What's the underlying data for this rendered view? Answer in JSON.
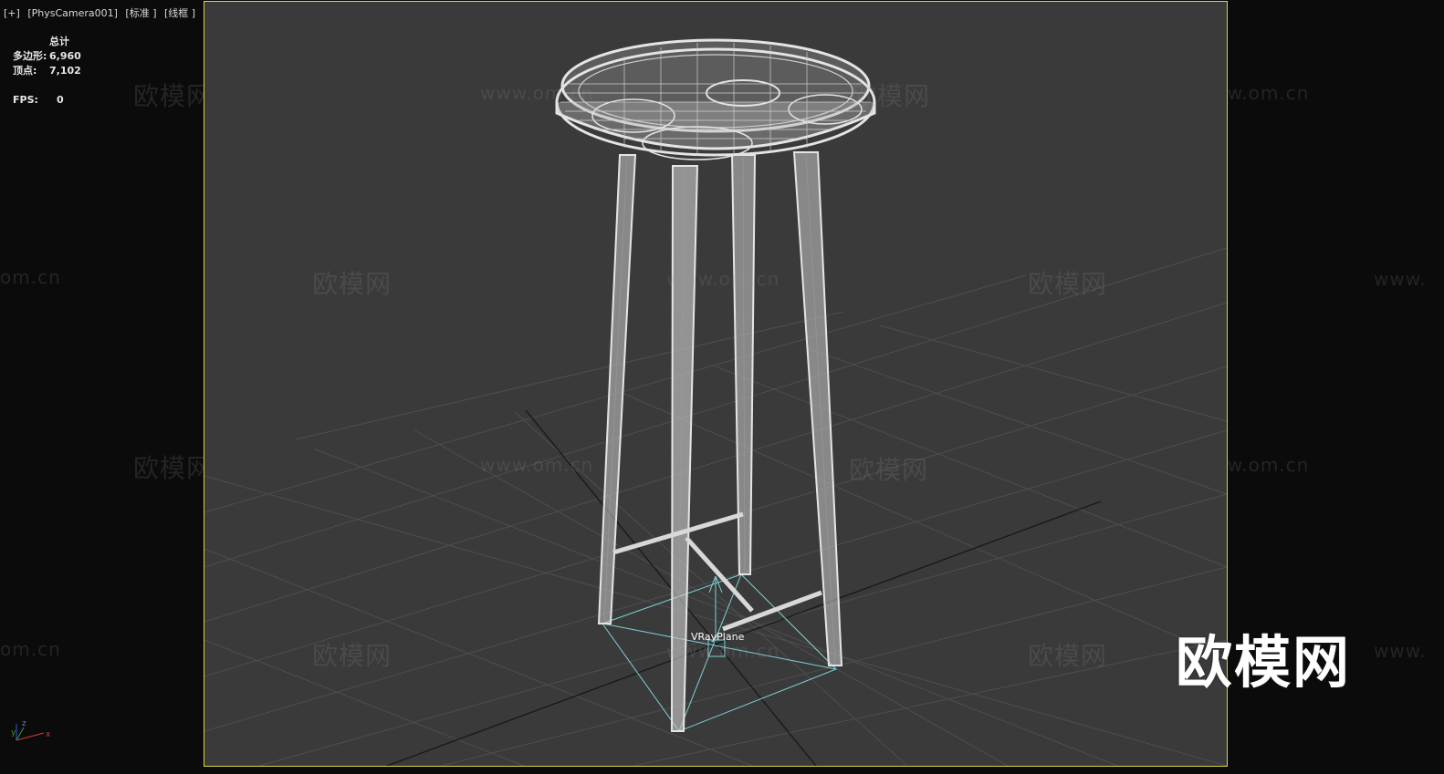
{
  "viewport_label": {
    "plus": "[+]",
    "camera": "[PhysCamera001]",
    "shading": "[标准 ]",
    "mode": "[线框 ]"
  },
  "stats": {
    "header": "总计",
    "polys_label": "多边形:",
    "polys_value": "6,960",
    "verts_label": "顶点:",
    "verts_value": "7,102",
    "fps_label": "FPS:",
    "fps_value": "0"
  },
  "scene": {
    "object_label": "VRayPlane"
  },
  "watermarks": {
    "brand_cn": "欧模网",
    "brand_url": "www.om.cn",
    "brand_url_partial": "www.",
    "brand_url_end": "om.cn",
    "logo_text": "欧模网"
  },
  "axis_gizmo": {
    "x": "x",
    "y": "y",
    "z": "z"
  },
  "colors": {
    "viewport_bg": "#3a3a3a",
    "viewport_border": "#d6d63a",
    "wireframe": "#e8e8e8",
    "grid": "#555555",
    "plane_gizmo": "#7fd0d8"
  }
}
